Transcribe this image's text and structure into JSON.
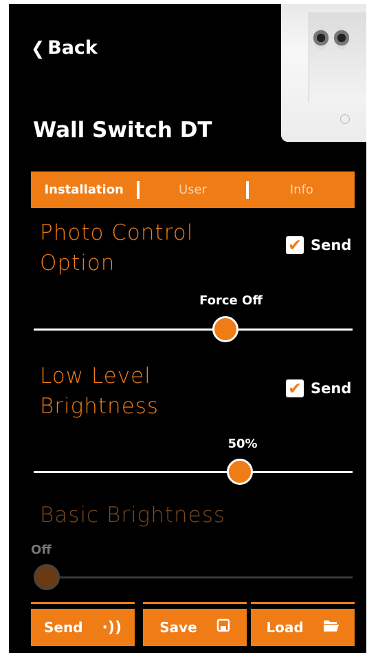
{
  "header": {
    "back_label": "Back",
    "title": "Wall Switch DT"
  },
  "tabs": [
    {
      "label": "Installation",
      "active": true
    },
    {
      "label": "User",
      "active": false
    },
    {
      "label": "Info",
      "active": false
    }
  ],
  "settings": [
    {
      "title_line1": "Photo Control",
      "title_line2": "Option",
      "send_label": "Send",
      "send_checked": true,
      "value_label": "Force Off",
      "slider_fraction": 0.61
    },
    {
      "title_line1": "Low Level",
      "title_line2": "Brightness",
      "send_label": "Send",
      "send_checked": true,
      "value_label": "50%",
      "slider_fraction": 0.66
    },
    {
      "title_line1": "Basic Brightness",
      "value_label": "Off",
      "slider_fraction": 0.0,
      "disabled": true
    }
  ],
  "footer": {
    "send_label": "Send",
    "save_label": "Save",
    "load_label": "Load"
  },
  "colors": {
    "accent": "#f07c16",
    "background": "#000000"
  },
  "icons": {
    "check": "checkmark-icon",
    "send": "wireless-send-icon",
    "save": "floppy-disk-icon",
    "load": "open-folder-icon",
    "back": "chevron-left-icon"
  }
}
